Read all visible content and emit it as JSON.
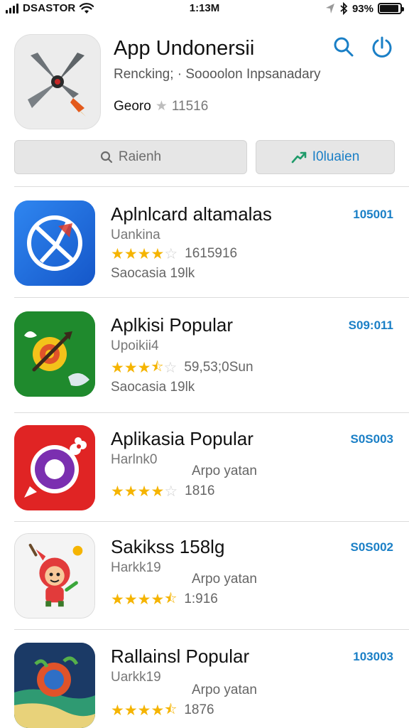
{
  "status_bar": {
    "carrier": "DSASTOR",
    "time": "1:13M",
    "battery": "93%",
    "battery_level": 0.93
  },
  "header": {
    "title": "App Undonersii",
    "subtitle": "Rencking; · Soooolon Inpsanadary",
    "developer": "Georo",
    "rating_count": "11516",
    "icon": "scissors-propeller-icon"
  },
  "buttons": {
    "search_label": "Raienh",
    "rate_label": "I0luaien"
  },
  "apps": [
    {
      "name": "Aplnlcard altamalas",
      "category": "Uankina",
      "stars": 4,
      "rating_count": "1615916",
      "subtext": "Saocasia 19lk",
      "note": "",
      "price": "105001",
      "icon": "compass-icon",
      "color": "#1e6fe0"
    },
    {
      "name": "Aplkisi Popular",
      "category": "Upoikii4",
      "stars": 3.5,
      "rating_count": "59,53;0Sun",
      "subtext": "Saocasia 19lk",
      "note": "",
      "price": "S09:011",
      "icon": "target-arrow-icon",
      "color": "#1f8a2d"
    },
    {
      "name": "Aplikasia Popular",
      "category": "Harlnk0",
      "stars": 4,
      "rating_count": "1816",
      "subtext": "",
      "note": "Arpo yatan",
      "price": "S0S003",
      "icon": "ring-flower-icon",
      "color": "#e02424"
    },
    {
      "name": "Sakikss 158lg",
      "category": "Harkk19",
      "stars": 4.5,
      "rating_count": "1:916",
      "subtext": "",
      "note": "Arpo yatan",
      "price": "S0S002",
      "icon": "cartoon-character-icon",
      "color": "#f4f4f4"
    },
    {
      "name": "Rallainsl Popular",
      "category": "Uarkk19",
      "stars": 4.5,
      "rating_count": "1876",
      "subtext": "",
      "note": "Arpo yatan",
      "price": "103003",
      "icon": "planet-globe-icon",
      "color": "#1b3a66"
    }
  ]
}
